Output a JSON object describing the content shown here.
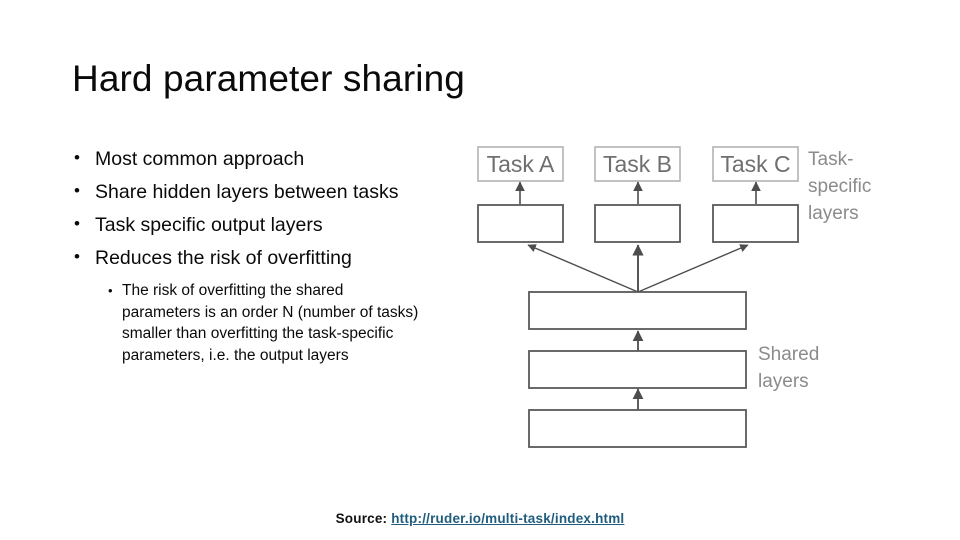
{
  "slide": {
    "title": "Hard parameter sharing",
    "bullets": [
      {
        "marker": "•",
        "text": "Most common approach"
      },
      {
        "marker": "•",
        "text": "Share hidden layers between tasks"
      },
      {
        "marker": "•",
        "text": "Task specific output layers"
      },
      {
        "marker": "•",
        "text": "Reduces the risk of overfitting"
      }
    ],
    "sub_bullets": [
      {
        "marker": "•",
        "text": "The risk of overfitting the shared parameters is an order N (number of tasks) smaller than overfitting the task-specific parameters,  i.e. the output layers"
      }
    ]
  },
  "diagram": {
    "task_boxes": [
      {
        "label": "Task A"
      },
      {
        "label": "Task B"
      },
      {
        "label": "Task C"
      }
    ],
    "task_hidden_boxes": [
      {
        "label": ""
      },
      {
        "label": ""
      },
      {
        "label": ""
      }
    ],
    "shared_boxes": [
      {
        "label": ""
      },
      {
        "label": ""
      },
      {
        "label": ""
      }
    ],
    "labels": {
      "task_specific": "Task-\nspecific\nlayers",
      "shared": "Shared\nlayers"
    },
    "colors": {
      "task_box_border": "#b3b3b3",
      "task_box_text": "#6f6f6f",
      "layer_box_border": "#595959",
      "arrow": "#4d4d4d",
      "label_text": "#8b8b8b"
    }
  },
  "source": {
    "prefix": "Source: ",
    "link_text": "http://ruder.io/multi-task/index.html",
    "link_color": "#1f5c7d"
  }
}
